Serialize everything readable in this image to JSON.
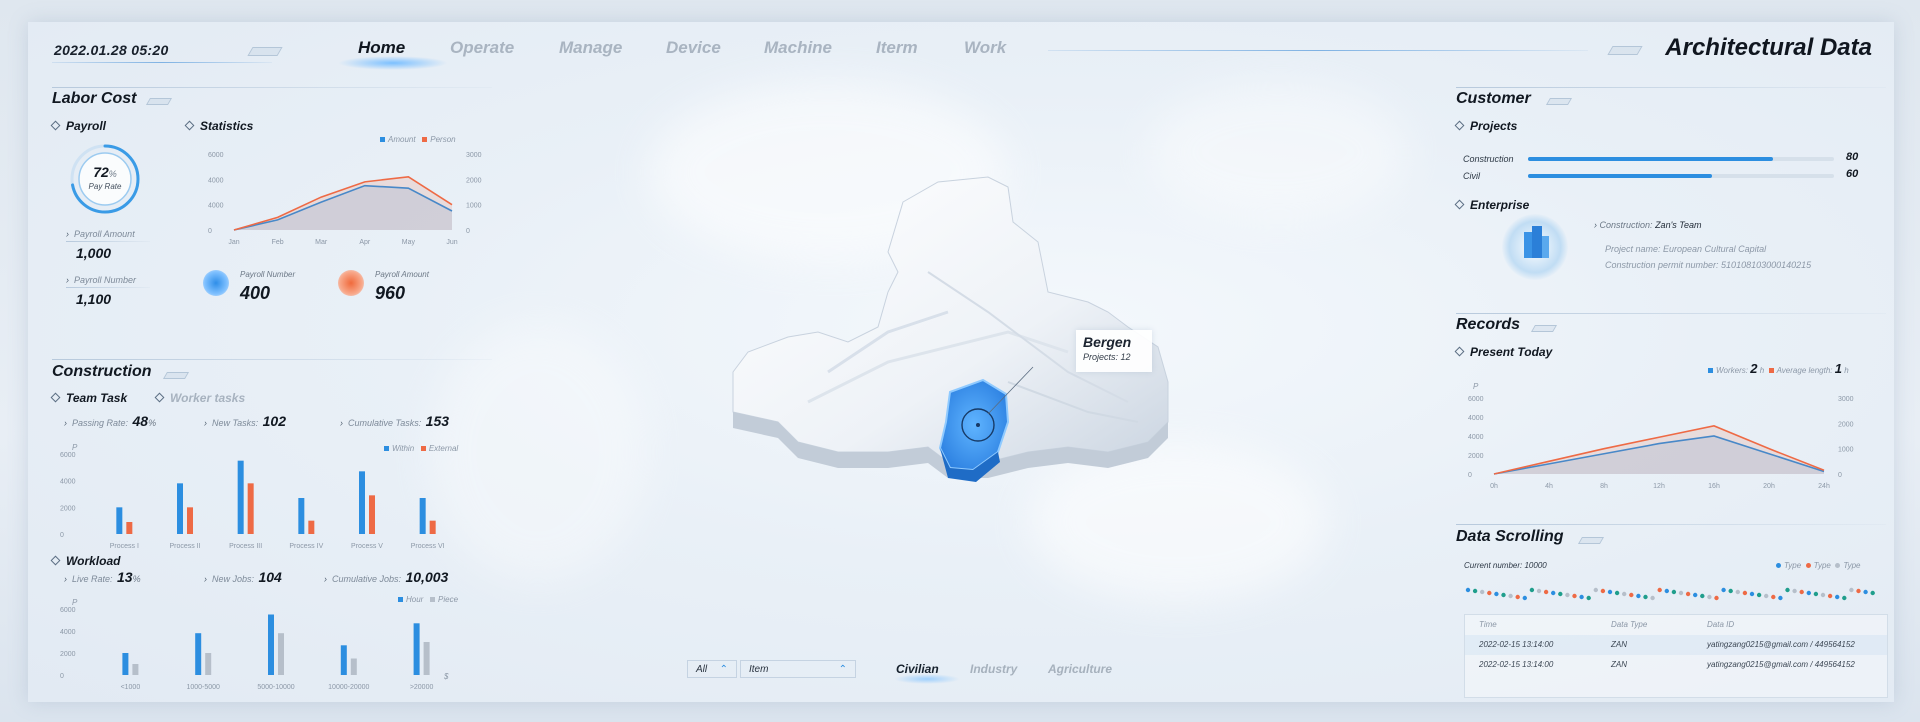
{
  "header": {
    "datetime": "2022.01.28   05:20",
    "nav": [
      {
        "label": "Home",
        "active": true
      },
      {
        "label": "Operate",
        "active": false
      },
      {
        "label": "Manage",
        "active": false
      },
      {
        "label": "Device",
        "active": false
      },
      {
        "label": "Machine",
        "active": false
      },
      {
        "label": "Iterm",
        "active": false
      },
      {
        "label": "Work",
        "active": false
      }
    ],
    "brand": "Architectural Data"
  },
  "labor_cost": {
    "title": "Labor Cost",
    "payroll": {
      "label": "Payroll",
      "rate_value": "72",
      "rate_unit": "%",
      "rate_label": "Pay Rate",
      "rate_fraction": 0.72,
      "amount_label": "Payroll Amount",
      "amount_value": "1,000",
      "number_label": "Payroll Number",
      "number_value": "1,100"
    },
    "statistics": {
      "label": "Statistics",
      "legend": [
        "Amount",
        "Person"
      ],
      "left_unit": "$",
      "right_unit": "$",
      "kpi1_label": "Payroll Number",
      "kpi1_value": "400",
      "kpi2_label": "Payroll Amount",
      "kpi2_value": "960"
    }
  },
  "construction": {
    "title": "Construction",
    "tab_active": "Team Task",
    "tab_inactive": "Worker tasks",
    "passing_rate_label": "Passing Rate:",
    "passing_rate_value": "48",
    "passing_rate_unit": "%",
    "new_tasks_label": "New Tasks:",
    "new_tasks_value": "102",
    "cum_tasks_label": "Cumulative Tasks:",
    "cum_tasks_value": "153",
    "y_unit": "P",
    "legend": [
      "Within",
      "External"
    ]
  },
  "workload": {
    "title": "Workload",
    "live_rate_label": "Live Rate:",
    "live_rate_value": "13",
    "live_rate_unit": "%",
    "new_jobs_label": "New Jobs:",
    "new_jobs_value": "104",
    "cum_jobs_label": "Cumulative Jobs:",
    "cum_jobs_value": "10,003",
    "y_unit": "P",
    "x_unit": "$",
    "legend": [
      "Hour",
      "Piece"
    ]
  },
  "map": {
    "city": "Bergen",
    "projects_label": "Projects:",
    "projects_value": "12"
  },
  "bottom": {
    "select1": "All",
    "select2": "Item",
    "tabs": [
      {
        "label": "Civilian",
        "active": true
      },
      {
        "label": "Industry",
        "active": false
      },
      {
        "label": "Agriculture",
        "active": false
      }
    ]
  },
  "customer": {
    "title": "Customer",
    "projects_label": "Projects",
    "projects": [
      {
        "label": "Construction",
        "value": "80",
        "fraction": 0.8
      },
      {
        "label": "Civil",
        "value": "60",
        "fraction": 0.6
      }
    ],
    "enterprise_label": "Enterprise",
    "construction_label": "Construction:",
    "construction_value": "Zan's Team",
    "project_name": "Project name: European Cultural Capital",
    "permit": "Construction permit number: 510108103000140215"
  },
  "records": {
    "title": "Records",
    "present_label": "Present Today",
    "workers_label": "Workers:",
    "workers_value": "2",
    "workers_unit": "h",
    "avg_label": "Average length:",
    "avg_value": "1",
    "avg_unit": "h",
    "y_unit": "P"
  },
  "data_scrolling": {
    "title": "Data Scrolling",
    "current": "Current number: 10000",
    "legend": [
      "Type",
      "Type",
      "Type"
    ],
    "columns": [
      "Time",
      "Data Type",
      "Data ID"
    ],
    "rows": [
      {
        "time": "2022-02-15 13:14:00",
        "type": "ZAN",
        "id": "yatingzang0215@gmail.com / 449564152"
      },
      {
        "time": "2022-02-15 13:14:00",
        "type": "ZAN",
        "id": "yatingzang0215@gmail.com / 449564152"
      }
    ]
  },
  "colors": {
    "blue": "#2c8ee0",
    "orange": "#ee6a45",
    "grey": "#b6bfca",
    "light_blue": "#8ec7f5"
  },
  "chart_data": [
    {
      "type": "line",
      "categories": [
        "Jan",
        "Feb",
        "Mar",
        "Apr",
        "May",
        "Jun"
      ],
      "left_axis": [
        "6000",
        "4000",
        "4000",
        "0"
      ],
      "right_axis": [
        "3000",
        "2000",
        "1000",
        "0"
      ],
      "series": [
        {
          "name": "Amount",
          "values": [
            0,
            800,
            2200,
            3500,
            3300,
            1500
          ]
        },
        {
          "name": "Person",
          "values": [
            0,
            1000,
            2600,
            3800,
            4200,
            2000
          ]
        }
      ],
      "ylim": [
        0,
        6000
      ]
    },
    {
      "type": "bar",
      "categories": [
        "Process I",
        "Process II",
        "Process III",
        "Process IV",
        "Process V",
        "Process VI"
      ],
      "y_ticks": [
        "6000",
        "4000",
        "2000",
        "0"
      ],
      "series": [
        {
          "name": "Within",
          "values": [
            2000,
            3800,
            5500,
            2700,
            4700,
            2700
          ]
        },
        {
          "name": "External",
          "values": [
            900,
            2000,
            3800,
            1000,
            2900,
            1000
          ]
        }
      ],
      "ylim": [
        0,
        6000
      ]
    },
    {
      "type": "bar",
      "categories": [
        "<1000",
        "1000-5000",
        "5000-10000",
        "10000-20000",
        ">20000"
      ],
      "y_ticks": [
        "6000",
        "4000",
        "2000",
        "0"
      ],
      "series": [
        {
          "name": "Hour",
          "values": [
            2000,
            3800,
            5500,
            2700,
            4700
          ]
        },
        {
          "name": "Piece",
          "values": [
            1000,
            2000,
            3800,
            1500,
            3000
          ]
        }
      ],
      "ylim": [
        0,
        6000
      ]
    },
    {
      "type": "area",
      "categories": [
        "0h",
        "4h",
        "8h",
        "12h",
        "16h",
        "20h",
        "24h"
      ],
      "left_axis": [
        "6000",
        "4000",
        "4000",
        "2000",
        "0"
      ],
      "right_axis": [
        "3000",
        "2000",
        "1000",
        "0"
      ],
      "series": [
        {
          "name": "Workers",
          "values": [
            0,
            800,
            1600,
            2400,
            3000,
            1600,
            200
          ]
        },
        {
          "name": "Average length",
          "values": [
            0,
            1000,
            2000,
            2900,
            3800,
            2000,
            300
          ]
        }
      ],
      "ylim": [
        0,
        6000
      ]
    }
  ]
}
